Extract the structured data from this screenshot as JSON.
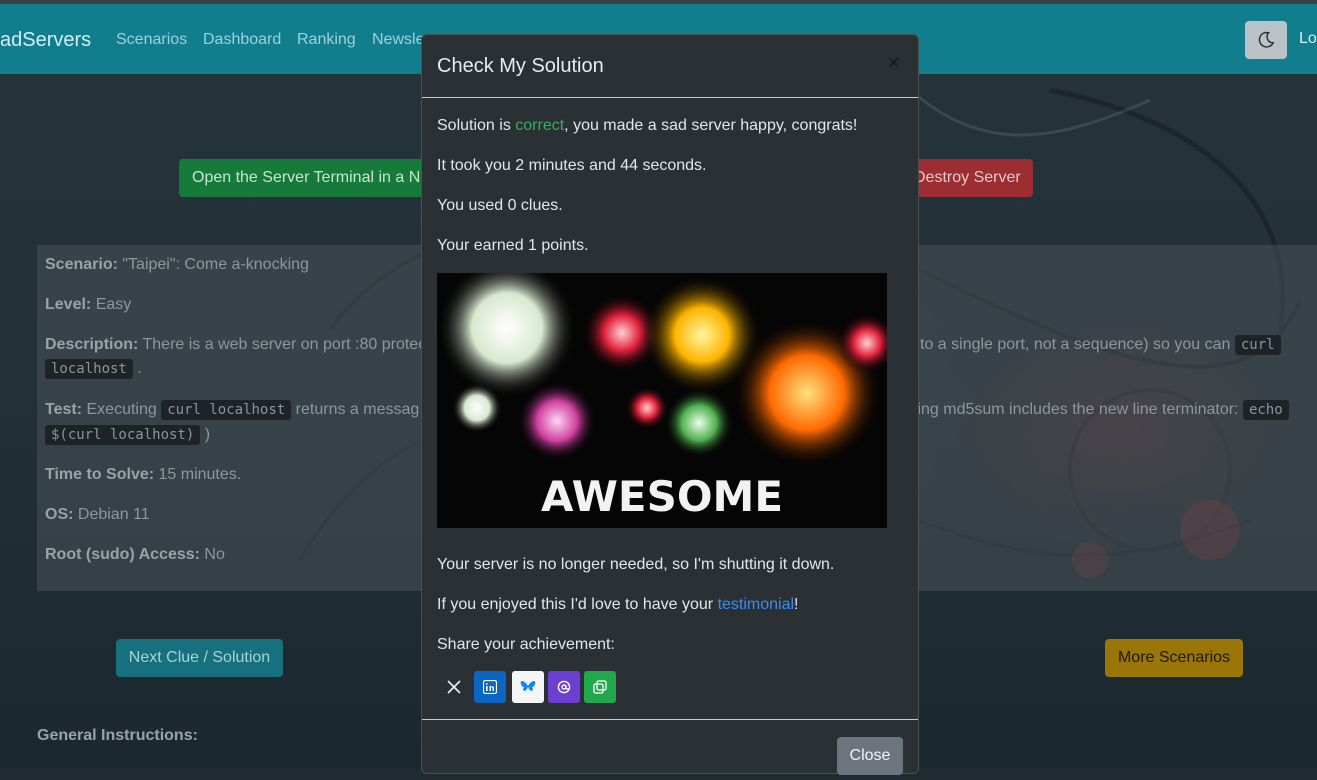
{
  "navbar": {
    "brand": "adServers",
    "links": [
      "Scenarios",
      "Dashboard",
      "Ranking",
      "Newsle"
    ],
    "login": "Lo"
  },
  "actions": {
    "open_terminal": "Open the Server Terminal in a New Tab",
    "destroy": "Destroy Server"
  },
  "scenario": {
    "scenario_label": "Scenario:",
    "scenario_value": " \"Taipei\": Come a-knocking",
    "level_label": "Level:",
    "level_value": " Easy",
    "description_label": "Description:",
    "description_value": " There is a web server on port :80 protec",
    "description_tail": "to a single port, not a sequence) so you can",
    "description_code1": "curl",
    "description_code2": "localhost",
    "test_label": "Test:",
    "test_value": " Executing",
    "test_code": "curl localhost",
    "test_value2": " returns a messag",
    "test_tail": "ting md5sum includes the new line terminator:",
    "test_code2": "echo",
    "test_code3": "$(curl localhost)",
    "time_label": "Time to Solve:",
    "time_value": " 15 minutes.",
    "os_label": "OS:",
    "os_value": " Debian 11",
    "root_label": "Root (sudo) Access:",
    "root_value": " No"
  },
  "bottom": {
    "next_clue": "Next Clue / Solution",
    "more": "More Scenarios",
    "general": "General Instructions:"
  },
  "modal": {
    "title": "Check My Solution",
    "close_x": "×",
    "line1_pre": "Solution is ",
    "line1_ok": "correct",
    "line1_post": ", you made a sad server happy, congrats!",
    "line2": "It took you 2 minutes and 44 seconds.",
    "line3": "You used 0 clues.",
    "line4": "Your earned 1 points.",
    "image_text": "AWESOME",
    "line5": "Your server is no longer needed, so I'm shutting it down.",
    "line6_pre": "If you enjoyed this I'd love to have your ",
    "line6_link": "testimonial",
    "line6_post": "!",
    "share": "Share your achievement:",
    "share_buttons": [
      "x-icon",
      "linkedin-icon",
      "bluesky-icon",
      "mastodon-icon",
      "copy-icon"
    ],
    "close": "Close"
  },
  "colors": {
    "navbar": "#117e8e",
    "correct": "#31b157",
    "link": "#3b8cf0",
    "modal_bg": "#2b3035"
  }
}
